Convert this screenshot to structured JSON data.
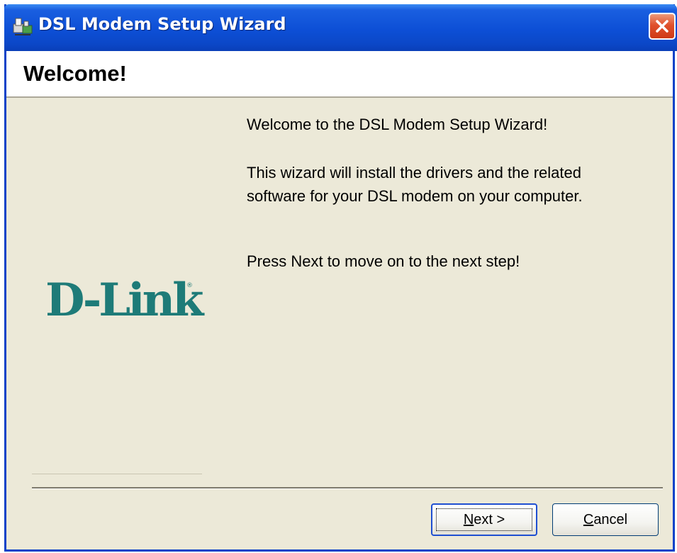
{
  "window": {
    "title": "DSL Modem Setup Wizard",
    "close_icon": "close-icon"
  },
  "header": {
    "title": "Welcome!"
  },
  "content": {
    "line1": "Welcome to the DSL Modem Setup Wizard!",
    "paragraph2": "This wizard will install the drivers and the related software for your DSL modem on your computer.",
    "paragraph3": "Press Next to move on to the next step!"
  },
  "logo": {
    "text": "D-Link",
    "registered_mark": "®"
  },
  "buttons": {
    "next_mnemonic": "N",
    "next_rest": "ext >",
    "cancel_mnemonic": "C",
    "cancel_rest": "ancel"
  },
  "colors": {
    "titlebar": "#0b47c7",
    "dialog_bg": "#ece9d8",
    "logo": "#1e7b78",
    "close_button": "#e0512c"
  }
}
